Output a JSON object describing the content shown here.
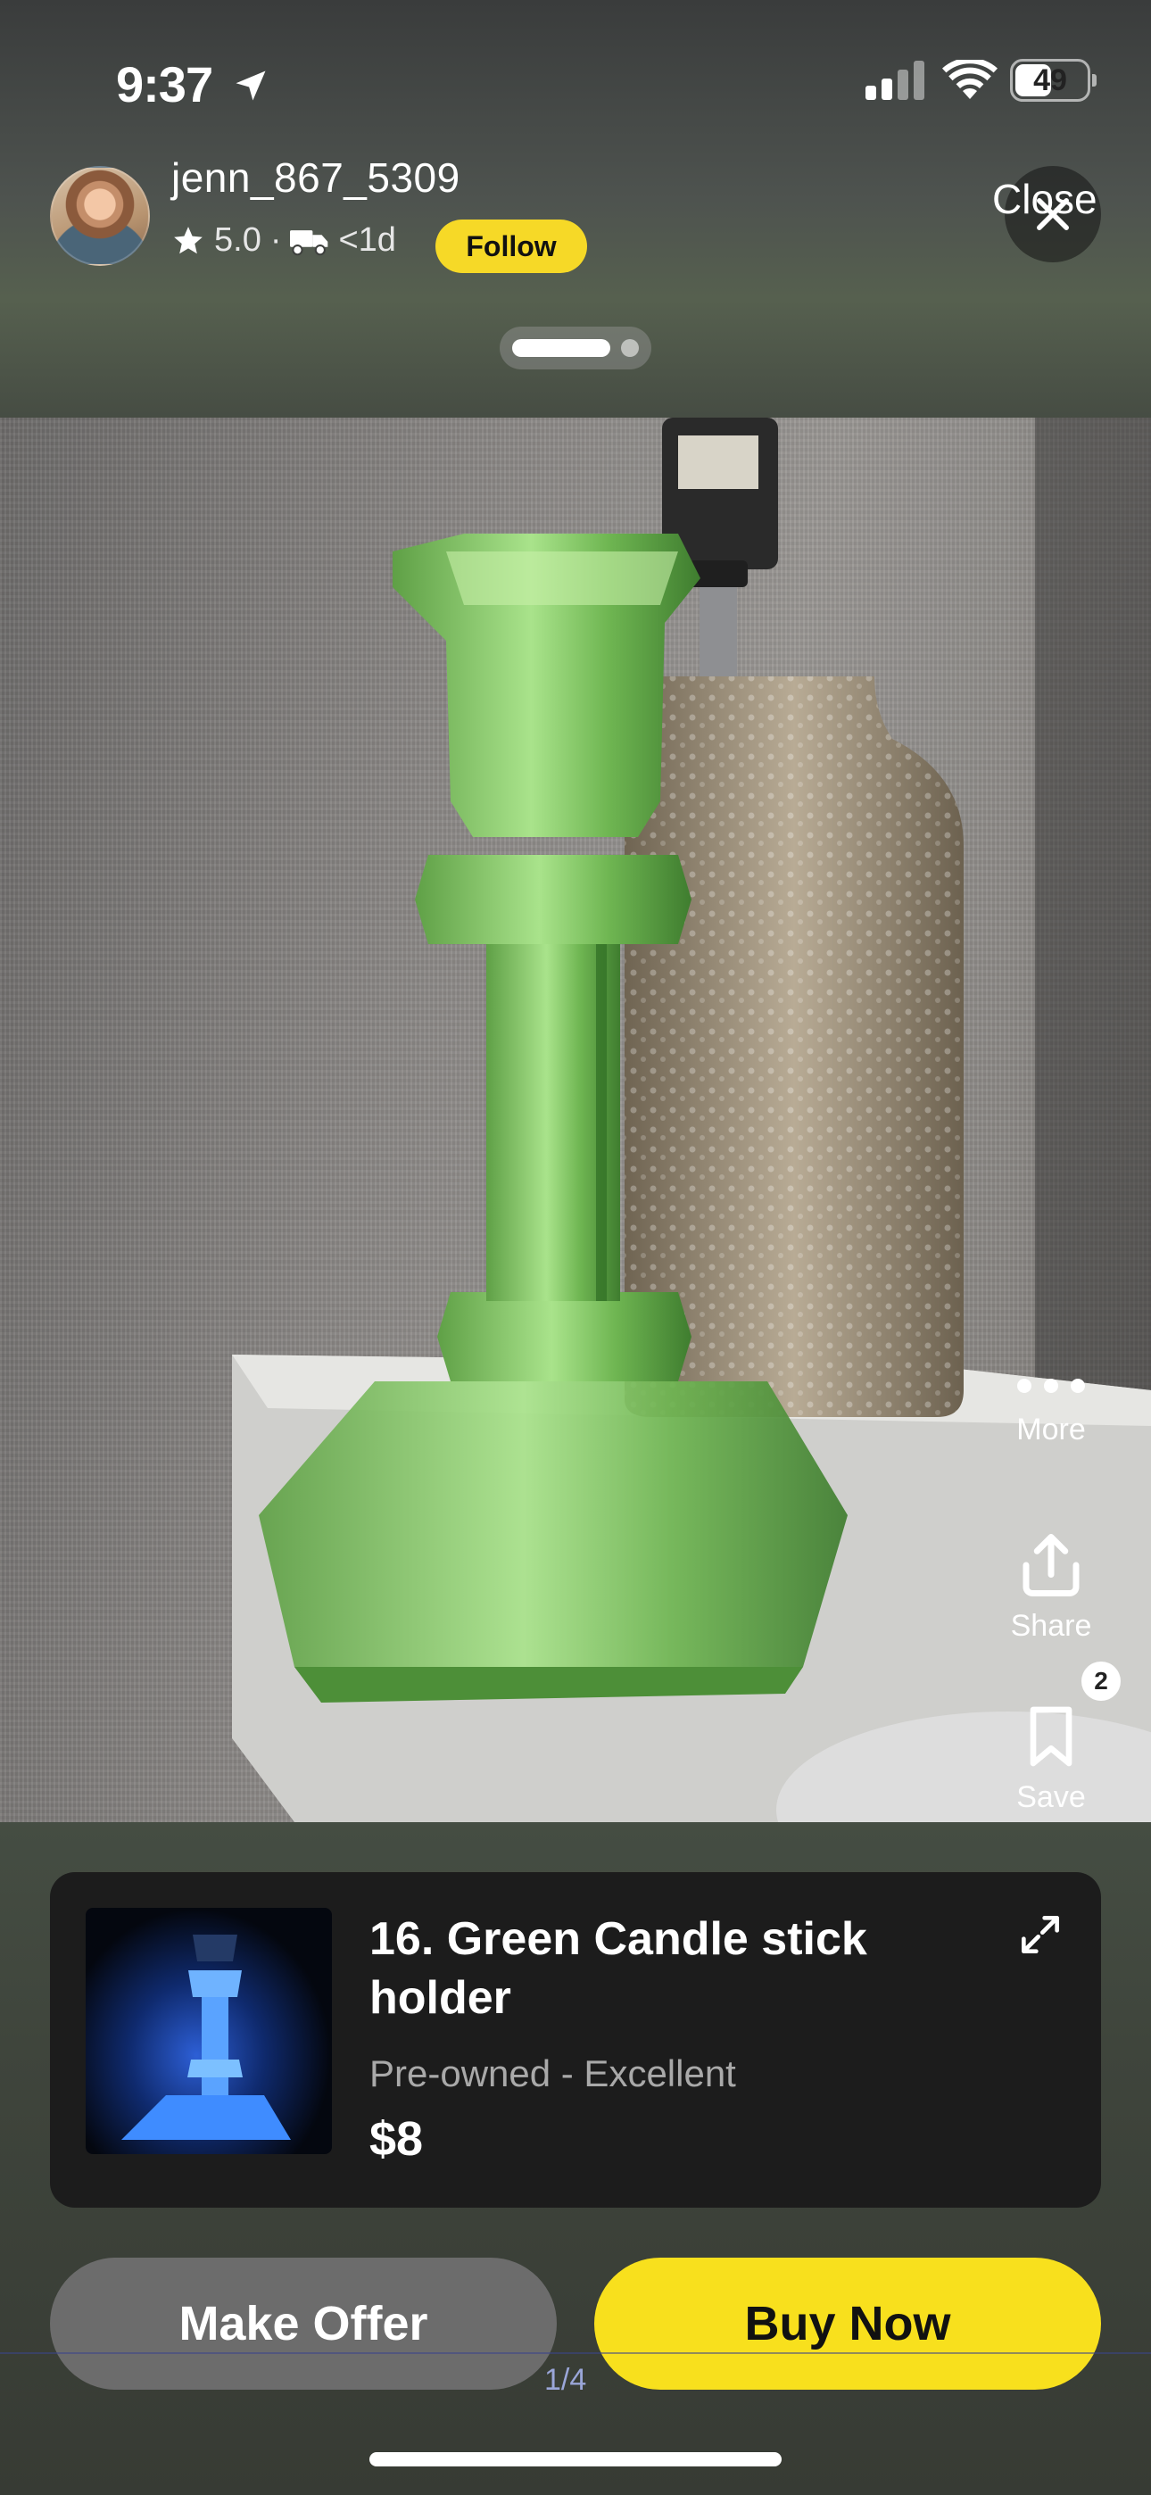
{
  "status_bar": {
    "time": "9:37",
    "battery": "49"
  },
  "seller": {
    "username": "jenn_867_5309",
    "rating": "5.0",
    "separator": "·",
    "shipping": "<1d",
    "follow_label": "Follow"
  },
  "header": {
    "close_label": "Close"
  },
  "side_actions": {
    "more_label": "More",
    "share_label": "Share",
    "save_label": "Save",
    "save_count": "2"
  },
  "listing": {
    "title": "16. Green Candle stick holder",
    "condition": "Pre-owned - Excellent",
    "price": "$8"
  },
  "buttons": {
    "make_offer": "Make Offer",
    "buy_now": "Buy Now"
  },
  "pager": {
    "counter": "1/4"
  },
  "colors": {
    "accent_yellow": "#f6d927",
    "card_background": "#1c1c1c",
    "offer_button": "#6c6c6c"
  },
  "icons": [
    "location-arrow-icon",
    "cellular-signal-icon",
    "wifi-icon",
    "battery-icon",
    "star-icon",
    "truck-icon",
    "close-icon",
    "more-icon",
    "share-icon",
    "bookmark-icon",
    "expand-icon"
  ]
}
